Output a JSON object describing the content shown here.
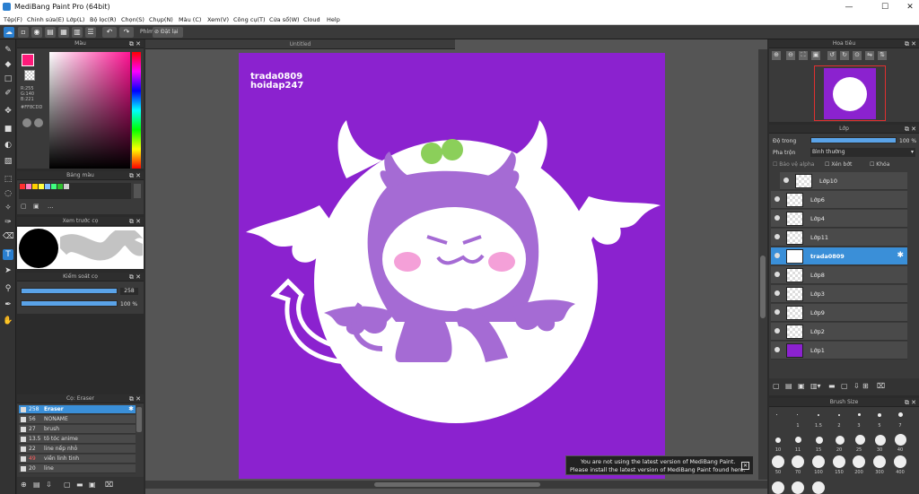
{
  "app": {
    "title": "MediBang Paint Pro (64bit)"
  },
  "menu": [
    "Tệp(F)",
    "Chỉnh sửa(E)",
    "Lớp(L)",
    "Bộ lọc(R)",
    "Chọn(S)",
    "Chụp(N)",
    "Màu (C)",
    "Xem(V)",
    "Công cụ(T)",
    "Cửa sổ(W)",
    "Cloud",
    "Help"
  ],
  "toolbar": {
    "phim_label": "Phím",
    "reset_label": "Đặt lại"
  },
  "color_panel": {
    "title": "Màu",
    "readout_r": "R:255",
    "readout_g": "G:140",
    "readout_b": "B:221",
    "hex": "#FF8CDD",
    "fg_color": "#ff1a7a"
  },
  "palette_panel": {
    "title": "Bảng màu",
    "swatches": [
      "#ff3030",
      "#ff80c0",
      "#ffd000",
      "#ffff40",
      "#80c0ff",
      "#40ff80",
      "#30c030",
      "#d0d0d0"
    ],
    "more": "..."
  },
  "preview_panel": {
    "title": "Xem trước cọ"
  },
  "brush_control_panel": {
    "title": "Kiểm soát cọ",
    "size": "258",
    "opacity": "100 %"
  },
  "brush_list_panel": {
    "title": "Cọ: Eraser",
    "items": [
      {
        "size": "258",
        "name": "Eraser"
      },
      {
        "size": "56",
        "name": "NONAME"
      },
      {
        "size": "27",
        "name": "brush"
      },
      {
        "size": "13.5",
        "name": "tô tóc anime"
      },
      {
        "size": "22",
        "name": "line nếp nhỏ"
      },
      {
        "size": "49",
        "name": "viền linh tinh"
      },
      {
        "size": "20",
        "name": "line"
      }
    ]
  },
  "canvas": {
    "tab_title": "Untitled",
    "watermark_line1": "trada0809",
    "watermark_line2": "hoidap247"
  },
  "navigator_panel": {
    "title": "Hoa tiêu"
  },
  "layer_panel": {
    "title": "Lớp",
    "opacity_label": "Độ trong",
    "opacity_value": "100 %",
    "blend_label": "Pha trộn",
    "blend_value": "Bình thường",
    "protect_alpha": "Bảo vệ alpha",
    "clipping": "Xén bớt",
    "lock": "Khóa",
    "layers": [
      "Lớp10",
      "Lớp6",
      "Lớp4",
      "Lớp11",
      "trada0809",
      "Lớp8",
      "Lớp3",
      "Lớp9",
      "Lớp2",
      "Lớp1"
    ]
  },
  "brush_size_panel": {
    "title": "Brush Size",
    "labels_row1": [
      "",
      "1",
      "1.5",
      "2",
      "3",
      "5",
      "7"
    ],
    "labels_row2": [
      "10",
      "11",
      "15",
      "20",
      "25",
      "30",
      "40"
    ],
    "labels_row3": [
      "50",
      "70",
      "100",
      "150",
      "200",
      "300",
      "400"
    ]
  },
  "notice": {
    "line1": "You are not using the latest version of MediBang Paint.",
    "line2": "Please install the latest version of MediBang Paint found here."
  },
  "colors": {
    "accent": "#3a8fd8",
    "canvas_bg": "#8b22cf"
  }
}
